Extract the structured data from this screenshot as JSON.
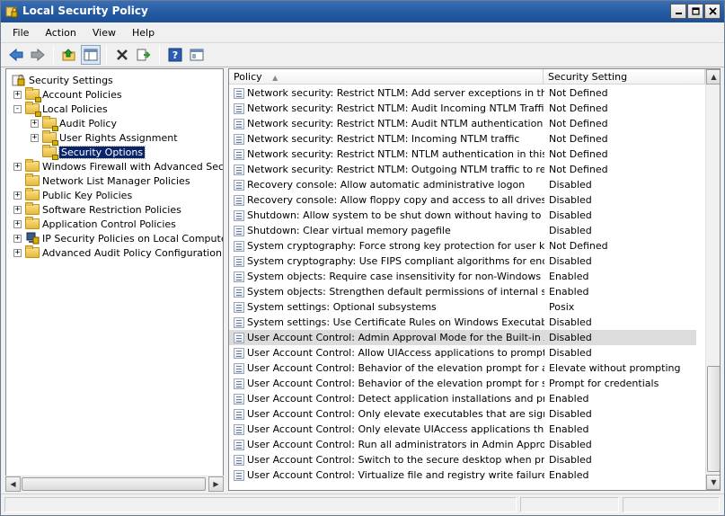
{
  "window": {
    "title": "Local Security Policy"
  },
  "menu": [
    "File",
    "Action",
    "View",
    "Help"
  ],
  "toolbar": [
    "back-icon",
    "forward-icon",
    "up-folder-icon",
    "show-hide-tree-icon",
    "delete-icon",
    "export-list-icon",
    "help-icon",
    "properties-icon"
  ],
  "tree": [
    {
      "label": "Security Settings",
      "level": 0,
      "expander": "none",
      "icon": "security-settings-icon"
    },
    {
      "label": "Account Policies",
      "level": 1,
      "expander": "+",
      "icon": "folder-lock-icon"
    },
    {
      "label": "Local Policies",
      "level": 1,
      "expander": "-",
      "icon": "folder-lock-icon"
    },
    {
      "label": "Audit Policy",
      "level": 2,
      "expander": "+",
      "icon": "folder-lock-icon"
    },
    {
      "label": "User Rights Assignment",
      "level": 2,
      "expander": "+",
      "icon": "folder-lock-icon"
    },
    {
      "label": "Security Options",
      "level": 2,
      "expander": "none",
      "icon": "folder-lock-icon",
      "selected": true
    },
    {
      "label": "Windows Firewall with Advanced Security",
      "level": 1,
      "expander": "+",
      "icon": "folder-icon"
    },
    {
      "label": "Network List Manager Policies",
      "level": 1,
      "expander": "none",
      "icon": "folder-icon"
    },
    {
      "label": "Public Key Policies",
      "level": 1,
      "expander": "+",
      "icon": "folder-icon"
    },
    {
      "label": "Software Restriction Policies",
      "level": 1,
      "expander": "+",
      "icon": "folder-icon"
    },
    {
      "label": "Application Control Policies",
      "level": 1,
      "expander": "+",
      "icon": "folder-icon"
    },
    {
      "label": "IP Security Policies on Local Computer",
      "level": 1,
      "expander": "+",
      "icon": "ip-security-icon"
    },
    {
      "label": "Advanced Audit Policy Configuration",
      "level": 1,
      "expander": "+",
      "icon": "folder-icon"
    }
  ],
  "columns": {
    "policy": "Policy",
    "setting": "Security Setting"
  },
  "rows": [
    {
      "policy": "Network security: Restrict NTLM: Add server exceptions in this d...",
      "setting": "Not Defined"
    },
    {
      "policy": "Network security: Restrict NTLM: Audit Incoming NTLM Traffic",
      "setting": "Not Defined"
    },
    {
      "policy": "Network security: Restrict NTLM: Audit NTLM authentication in thi...",
      "setting": "Not Defined"
    },
    {
      "policy": "Network security: Restrict NTLM: Incoming NTLM traffic",
      "setting": "Not Defined"
    },
    {
      "policy": "Network security: Restrict NTLM: NTLM authentication in this dom...",
      "setting": "Not Defined"
    },
    {
      "policy": "Network security: Restrict NTLM: Outgoing NTLM traffic to remot...",
      "setting": "Not Defined"
    },
    {
      "policy": "Recovery console: Allow automatic administrative logon",
      "setting": "Disabled"
    },
    {
      "policy": "Recovery console: Allow floppy copy and access to all drives and ...",
      "setting": "Disabled"
    },
    {
      "policy": "Shutdown: Allow system to be shut down without having to log on",
      "setting": "Disabled"
    },
    {
      "policy": "Shutdown: Clear virtual memory pagefile",
      "setting": "Disabled"
    },
    {
      "policy": "System cryptography: Force strong key protection for user keys ...",
      "setting": "Not Defined"
    },
    {
      "policy": "System cryptography: Use FIPS compliant algorithms for encrypti...",
      "setting": "Disabled"
    },
    {
      "policy": "System objects: Require case insensitivity for non-Windows subs...",
      "setting": "Enabled"
    },
    {
      "policy": "System objects: Strengthen default permissions of internal syste...",
      "setting": "Enabled"
    },
    {
      "policy": "System settings: Optional subsystems",
      "setting": "Posix"
    },
    {
      "policy": "System settings: Use Certificate Rules on Windows Executables f...",
      "setting": "Disabled"
    },
    {
      "policy": "User Account Control: Admin Approval Mode for the Built-in Admi...",
      "setting": "Disabled",
      "highlight": true
    },
    {
      "policy": "User Account Control: Allow UIAccess applications to prompt for ...",
      "setting": "Disabled"
    },
    {
      "policy": "User Account Control: Behavior of the elevation prompt for admi...",
      "setting": "Elevate without prompting"
    },
    {
      "policy": "User Account Control: Behavior of the elevation prompt for stand...",
      "setting": "Prompt for credentials"
    },
    {
      "policy": "User Account Control: Detect application installations and prompt...",
      "setting": "Enabled"
    },
    {
      "policy": "User Account Control: Only elevate executables that are signed ...",
      "setting": "Disabled"
    },
    {
      "policy": "User Account Control: Only elevate UIAccess applications that ar...",
      "setting": "Enabled"
    },
    {
      "policy": "User Account Control: Run all administrators in Admin Approval M...",
      "setting": "Disabled"
    },
    {
      "policy": "User Account Control: Switch to the secure desktop when prompt...",
      "setting": "Disabled"
    },
    {
      "policy": "User Account Control: Virtualize file and registry write failures to ...",
      "setting": "Enabled"
    }
  ],
  "colors": {
    "titlebar": "#245aa2",
    "selection": "#0a246a",
    "row_highlight": "#dcdcdc"
  }
}
